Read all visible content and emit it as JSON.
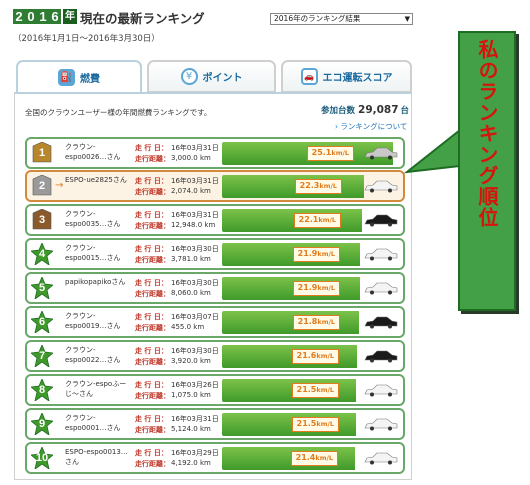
{
  "header": {
    "year_digits": [
      "2",
      "0",
      "1",
      "6"
    ],
    "year_suffix": "年",
    "title": "現在の最新ランキング",
    "period": "（2016年1月1日～2016年3月30日）",
    "select_value": "2016年のランキング結果"
  },
  "tabs": [
    {
      "label": "燃費",
      "icon": "fuel-pump-icon",
      "active": true
    },
    {
      "label": "ポイント",
      "icon": "coin-icon",
      "active": false
    },
    {
      "label": "エコ運転スコア",
      "icon": "eco-car-icon",
      "active": false
    }
  ],
  "summary": {
    "intro": "全国のクラウンユーザー様の年間燃費ランキングです。",
    "participants_label": "参加台数",
    "participants_value": "29,087",
    "participants_unit": "台",
    "about_link": "› ランキングについて"
  },
  "labels": {
    "run_date": "走 行 日：",
    "distance": "走行距離："
  },
  "unit": "km/L",
  "colors": {
    "bar": "#3f9a2a",
    "mine_border": "#d48a3c",
    "accent_orange": "#e07b1e",
    "gold": "#b8862b",
    "silver": "#9a9a9a",
    "bronze": "#8a5a2b",
    "star": "#3f9a2a",
    "callout": "#43a047",
    "callout_text": "#d7140b"
  },
  "rows": [
    {
      "rank": "1",
      "badge": "gold",
      "user": "クラウン-espo0026…さん",
      "date": "16年03月31日",
      "distance": "3,000.0 km",
      "fuel": "25.1",
      "car_color": "silver",
      "mine": false
    },
    {
      "rank": "2",
      "badge": "silver",
      "user": "ESPO-ue2825さん",
      "date": "16年03月31日",
      "distance": "2,074.0 km",
      "fuel": "22.3",
      "car_color": "white",
      "mine": true
    },
    {
      "rank": "3",
      "badge": "bronze",
      "user": "クラウン-espo0035…さん",
      "date": "16年03月31日",
      "distance": "12,948.0 km",
      "fuel": "22.1",
      "car_color": "black",
      "mine": false
    },
    {
      "rank": "4",
      "badge": "star",
      "user": "クラウン-espo0015…さん",
      "date": "16年03月30日",
      "distance": "3,781.0 km",
      "fuel": "21.9",
      "car_color": "white",
      "mine": false
    },
    {
      "rank": "5",
      "badge": "star",
      "user": "papikopapikoさん",
      "date": "16年03月30日",
      "distance": "8,060.0 km",
      "fuel": "21.9",
      "car_color": "white",
      "mine": false
    },
    {
      "rank": "6",
      "badge": "star",
      "user": "クラウン-espo0019…さん",
      "date": "16年03月07日",
      "distance": "455.0 km",
      "fuel": "21.8",
      "car_color": "black",
      "mine": false
    },
    {
      "rank": "7",
      "badge": "star",
      "user": "クラウン-espo0022…さん",
      "date": "16年03月30日",
      "distance": "3,920.0 km",
      "fuel": "21.6",
      "car_color": "black",
      "mine": false
    },
    {
      "rank": "8",
      "badge": "star",
      "user": "クラウン-espoふーじ～さん",
      "date": "16年03月26日",
      "distance": "1,075.0 km",
      "fuel": "21.5",
      "car_color": "white",
      "mine": false
    },
    {
      "rank": "9",
      "badge": "star",
      "user": "クラウン-espo0001…さん",
      "date": "16年03月31日",
      "distance": "5,124.0 km",
      "fuel": "21.5",
      "car_color": "white",
      "mine": false
    },
    {
      "rank": "10",
      "badge": "star",
      "user": "ESPO-espo0013…さん",
      "date": "16年03月29日",
      "distance": "4,192.0 km",
      "fuel": "21.4",
      "car_color": "white",
      "mine": false
    }
  ],
  "callout": {
    "text": "私のランキング順位"
  }
}
